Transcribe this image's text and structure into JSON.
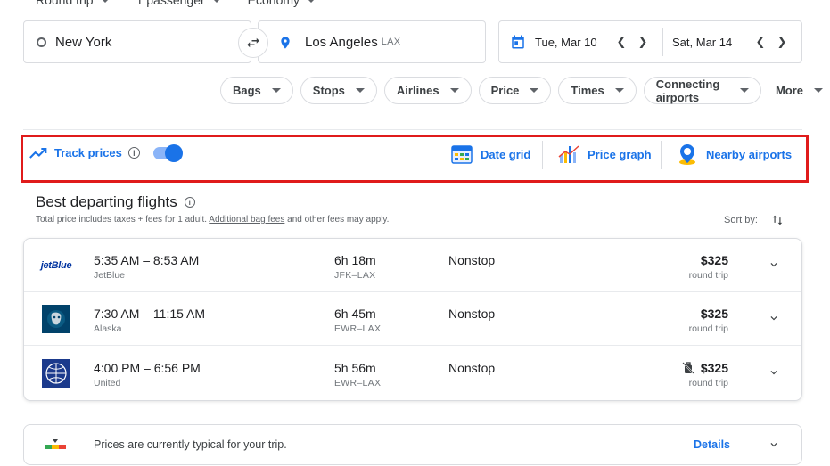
{
  "top_selectors": {
    "trip_type": "Round trip",
    "passengers": "1 passenger",
    "cabin": "Economy"
  },
  "search": {
    "origin": "New York",
    "destination": "Los Angeles",
    "destination_code": "LAX",
    "depart_date": "Tue, Mar 10",
    "return_date": "Sat, Mar 14"
  },
  "filters": [
    "Bags",
    "Stops",
    "Airlines",
    "Price",
    "Times",
    "Connecting airports",
    "More"
  ],
  "tools": {
    "track_prices": "Track prices",
    "track_enabled": true,
    "date_grid": "Date grid",
    "price_graph": "Price graph",
    "nearby_airports": "Nearby airports"
  },
  "results": {
    "title": "Best departing flights",
    "note_pre": "Total price includes taxes + fees for 1 adult. ",
    "note_link": "Additional bag fees",
    "note_post": " and other fees may apply.",
    "sort_label": "Sort by:",
    "flights": [
      {
        "times": "5:35 AM – 8:53 AM",
        "airline": "JetBlue",
        "duration": "6h 18m",
        "route": "JFK–LAX",
        "stops": "Nonstop",
        "price": "$325",
        "price_type": "round trip",
        "logo": "jetblue-logo"
      },
      {
        "times": "7:30 AM – 11:15 AM",
        "airline": "Alaska",
        "duration": "6h 45m",
        "route": "EWR–LAX",
        "stops": "Nonstop",
        "price": "$325",
        "price_type": "round trip",
        "logo": "alaska-logo"
      },
      {
        "times": "4:00 PM – 6:56 PM",
        "airline": "United",
        "duration": "5h 56m",
        "route": "EWR–LAX",
        "stops": "Nonstop",
        "price": "$325",
        "price_type": "round trip",
        "logo": "united-logo",
        "no_carry_on_icon": "no-carry-on-bag-icon"
      }
    ]
  },
  "insight": {
    "text": "Prices are currently typical for your trip.",
    "details": "Details"
  },
  "logo_text": {
    "jetblue": "jetBlue"
  },
  "colors": {
    "accent": "#1a73e8",
    "highlight_box": "#e01b1b"
  }
}
